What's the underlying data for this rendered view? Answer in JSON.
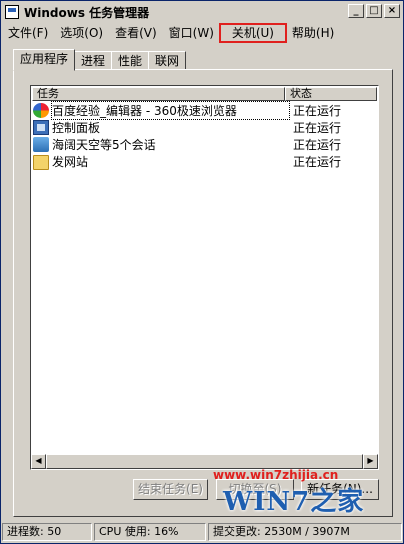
{
  "window": {
    "title": "Windows 任务管理器",
    "buttons": [
      "_",
      "□",
      "×"
    ]
  },
  "menu": [
    "文件(F)",
    "选项(O)",
    "查看(V)",
    "窗口(W)",
    "关机(U)",
    "帮助(H)"
  ],
  "highlighted_menu_color": "#e0201e",
  "tabs": [
    "应用程序",
    "进程",
    "性能",
    "联网"
  ],
  "list": {
    "headers": {
      "task": "任务",
      "status": "状态"
    },
    "rows": [
      {
        "name": "百度经验_编辑器 - 360极速浏览器",
        "status": "正在运行",
        "icon": "browser-icon"
      },
      {
        "name": "控制面板",
        "status": "正在运行",
        "icon": "control-panel-icon"
      },
      {
        "name": "海阔天空等5个会话",
        "status": "正在运行",
        "icon": "chat-icon"
      },
      {
        "name": "发网站",
        "status": "正在运行",
        "icon": "folder-icon"
      }
    ]
  },
  "buttons": {
    "end_task": "结束任务(E)",
    "switch_to": "切换至(S)",
    "new_task": "新任务(N)..."
  },
  "watermark": {
    "url": "www.win7zhijia.cn",
    "logo": "WIN7之家"
  },
  "status": {
    "processes": "进程数: 50",
    "cpu": "CPU 使用: 16%",
    "commit": "提交更改: 2530M / 3907M"
  }
}
